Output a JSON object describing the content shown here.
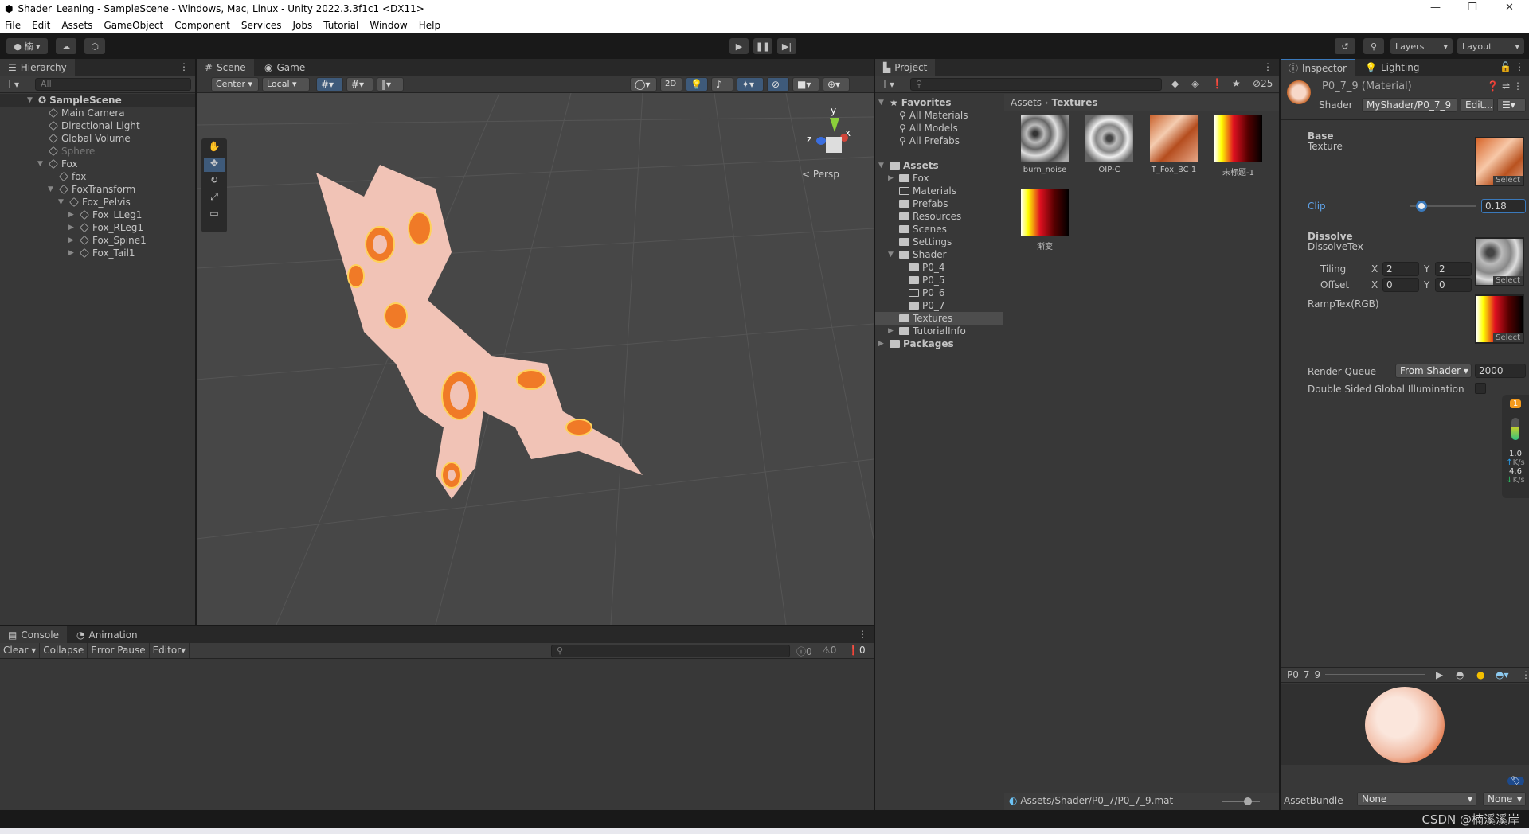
{
  "window": {
    "title": "Shader_Leaning - SampleScene - Windows, Mac, Linux - Unity 2022.3.3f1c1 <DX11>",
    "min": "—",
    "max": "❐",
    "close": "✕"
  },
  "menu": [
    "File",
    "Edit",
    "Assets",
    "GameObject",
    "Component",
    "Services",
    "Jobs",
    "Tutorial",
    "Window",
    "Help"
  ],
  "toolbar": {
    "account": "楠",
    "layers": "Layers",
    "layout": "Layout"
  },
  "hierarchy": {
    "tab": "Hierarchy",
    "search_placeholder": "All",
    "scene": "SampleScene",
    "items": [
      {
        "label": "Main Camera",
        "depth": 1,
        "arrow": ""
      },
      {
        "label": "Directional Light",
        "depth": 1,
        "arrow": ""
      },
      {
        "label": "Global Volume",
        "depth": 1,
        "arrow": ""
      },
      {
        "label": "Sphere",
        "depth": 1,
        "arrow": "",
        "disabled": true
      },
      {
        "label": "Fox",
        "depth": 1,
        "arrow": "▼"
      },
      {
        "label": "fox",
        "depth": 2,
        "arrow": ""
      },
      {
        "label": "FoxTransform",
        "depth": 2,
        "arrow": "▼"
      },
      {
        "label": "Fox_Pelvis",
        "depth": 3,
        "arrow": "▼"
      },
      {
        "label": "Fox_LLeg1",
        "depth": 4,
        "arrow": "▶"
      },
      {
        "label": "Fox_RLeg1",
        "depth": 4,
        "arrow": "▶"
      },
      {
        "label": "Fox_Spine1",
        "depth": 4,
        "arrow": "▶"
      },
      {
        "label": "Fox_Tail1",
        "depth": 4,
        "arrow": "▶"
      }
    ]
  },
  "scene": {
    "tabs": [
      "Scene",
      "Game"
    ],
    "pivot": "Center",
    "space": "Local",
    "mode_2d": "2D",
    "persp": "< Persp",
    "gizmo": {
      "y": "y",
      "x": "x",
      "z": "z"
    }
  },
  "project": {
    "tab": "Project",
    "hidden_count": "25",
    "breadcrumb": [
      "Assets",
      "Textures"
    ],
    "favorites": {
      "label": "Favorites",
      "items": [
        "All Materials",
        "All Models",
        "All Prefabs"
      ]
    },
    "tree": [
      {
        "label": "Assets",
        "depth": 0,
        "arrow": "▼",
        "bold": true
      },
      {
        "label": "Fox",
        "depth": 1,
        "arrow": "▶"
      },
      {
        "label": "Materials",
        "depth": 1,
        "arrow": "",
        "empty": true
      },
      {
        "label": "Prefabs",
        "depth": 1,
        "arrow": ""
      },
      {
        "label": "Resources",
        "depth": 1,
        "arrow": ""
      },
      {
        "label": "Scenes",
        "depth": 1,
        "arrow": ""
      },
      {
        "label": "Settings",
        "depth": 1,
        "arrow": ""
      },
      {
        "label": "Shader",
        "depth": 1,
        "arrow": "▼"
      },
      {
        "label": "P0_4",
        "depth": 2,
        "arrow": ""
      },
      {
        "label": "P0_5",
        "depth": 2,
        "arrow": ""
      },
      {
        "label": "P0_6",
        "depth": 2,
        "arrow": "",
        "empty": true
      },
      {
        "label": "P0_7",
        "depth": 2,
        "arrow": ""
      },
      {
        "label": "Textures",
        "depth": 1,
        "arrow": "",
        "selected": true
      },
      {
        "label": "TutorialInfo",
        "depth": 1,
        "arrow": "▶"
      },
      {
        "label": "Packages",
        "depth": 0,
        "arrow": "▶",
        "bold": true
      }
    ],
    "assets": [
      {
        "name": "burn_noise",
        "kind": "noise"
      },
      {
        "name": "OIP-C",
        "kind": "cells"
      },
      {
        "name": "T_Fox_BC 1",
        "kind": "fox"
      },
      {
        "name": "未标题-1",
        "kind": "ramp"
      },
      {
        "name": "渐变",
        "kind": "ramp"
      }
    ],
    "path": "Assets/Shader/P0_7/P0_7_9.mat"
  },
  "inspector": {
    "tabs": [
      "Inspector",
      "Lighting"
    ],
    "title": "P0_7_9 (Material)",
    "shader_label": "Shader",
    "shader": "MyShader/P0_7_9",
    "edit": "Edit...",
    "base_header": "Base",
    "base_tex": "Texture",
    "select": "Select",
    "clip_label": "Clip",
    "clip_value": "0.18",
    "clip_min": 0,
    "clip_max": 1,
    "dissolve_header": "Dissolve",
    "dissolve_tex": "DissolveTex",
    "tiling": "Tiling",
    "offset": "Offset",
    "x": "X",
    "y": "Y",
    "tiling_x": "2",
    "tiling_y": "2",
    "offset_x": "0",
    "offset_y": "0",
    "ramp": "RampTex(RGB)",
    "render_queue": "Render Queue",
    "rq_mode": "From Shader",
    "rq_value": "2000",
    "dsgi": "Double Sided Global Illumination",
    "preview_name": "P0_7_9",
    "assetbundle": "AssetBundle",
    "ab_name": "None",
    "ab_variant": "None",
    "net": {
      "up": "1.0",
      "down": "4.6",
      "unit": "K/s",
      "badge": "1"
    },
    "accent": "#3a79bb"
  },
  "console": {
    "tabs": [
      "Console",
      "Animation"
    ],
    "clear": "Clear",
    "collapse": "Collapse",
    "error_pause": "Error Pause",
    "editor": "Editor",
    "info": "0",
    "warn": "0",
    "error": "0"
  },
  "watermark": "CSDN @楠溪溪岸"
}
